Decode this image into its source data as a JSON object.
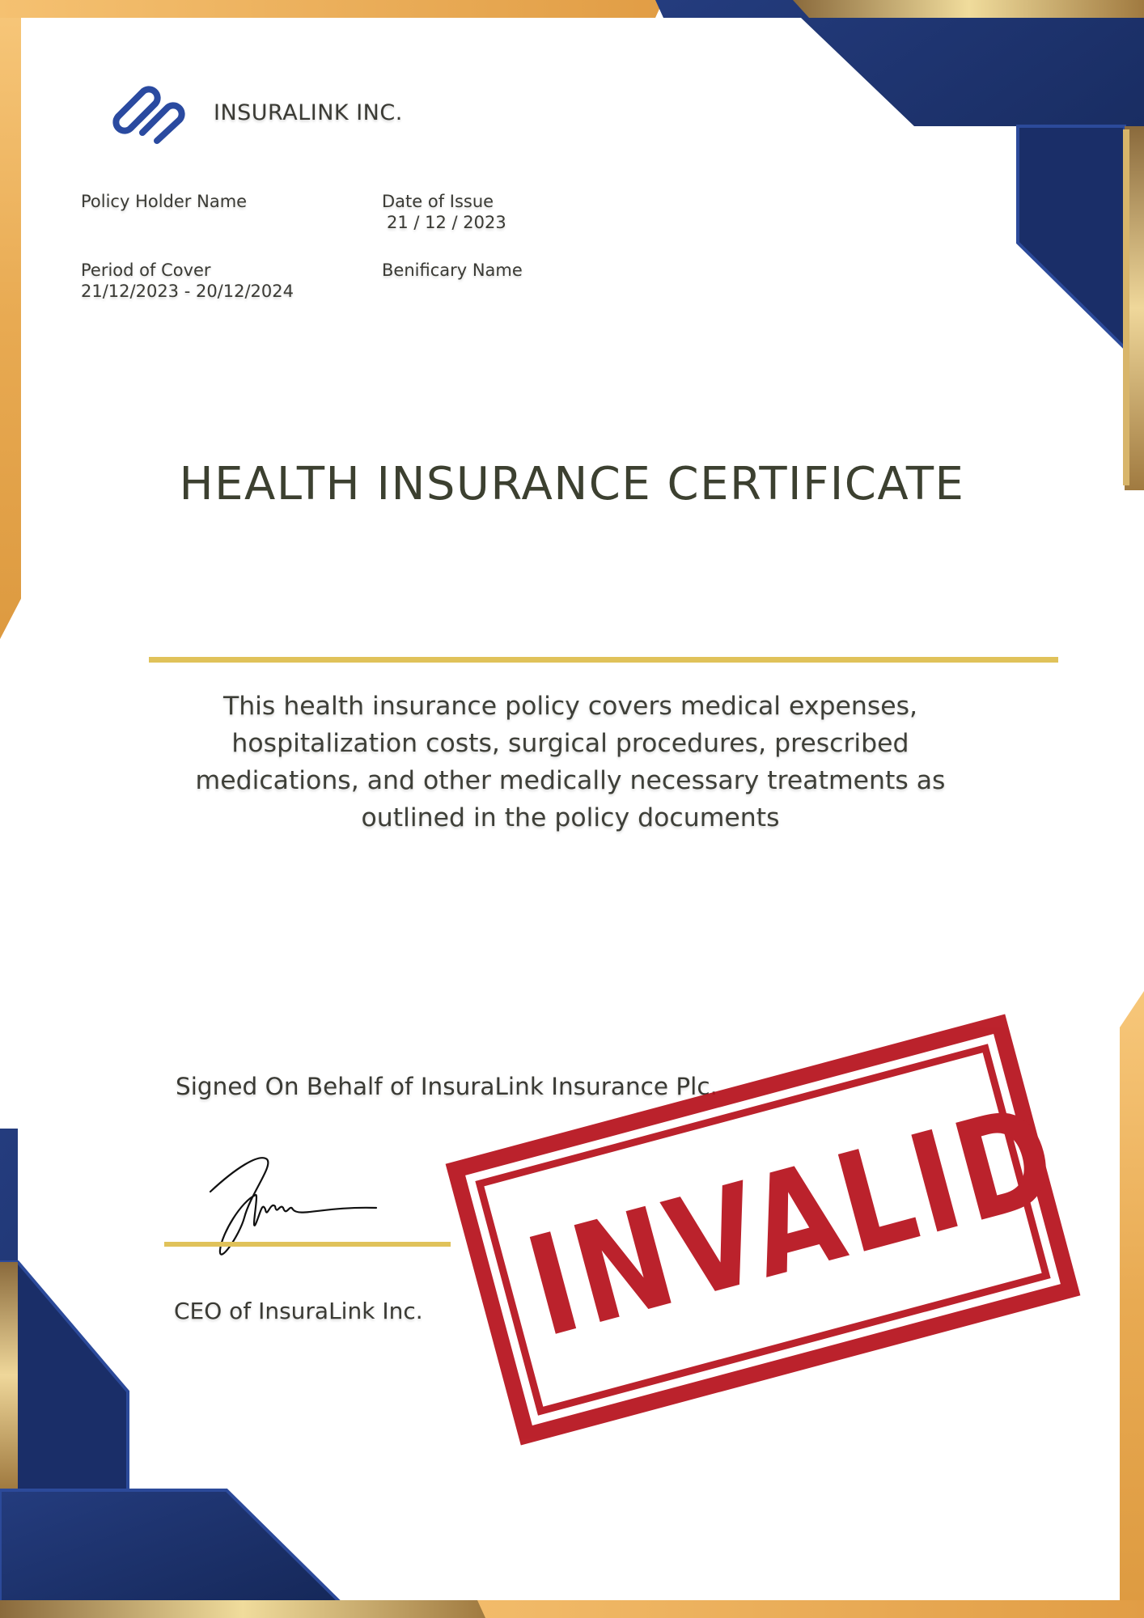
{
  "header": {
    "company_name": "INSURALINK INC."
  },
  "policy": {
    "holder_label": "Policy Holder Name",
    "issue_label": "Date of Issue",
    "issue_value": "21 / 12 / 2023",
    "cover_label": "Period of Cover",
    "cover_value": "21/12/2023 - 20/12/2024",
    "beneficiary_label": "Benificary Name"
  },
  "certificate": {
    "title": "HEALTH INSURANCE CERTIFICATE",
    "description": "This health insurance policy covers medical expenses, hospitalization costs, surgical procedures, prescribed medications, and other medically necessary treatments as outlined in the policy documents"
  },
  "signature": {
    "signed_on_behalf": "Signed On Behalf of InsuraLink Insurance Plc.",
    "signer_title": "CEO of InsuraLink Inc."
  },
  "stamp": {
    "text": "INVALID"
  },
  "colors": {
    "navy": "#1e3470",
    "gold": "#e0a850",
    "stamp_red": "#b6101b",
    "rule_gold": "#e0c25a"
  }
}
